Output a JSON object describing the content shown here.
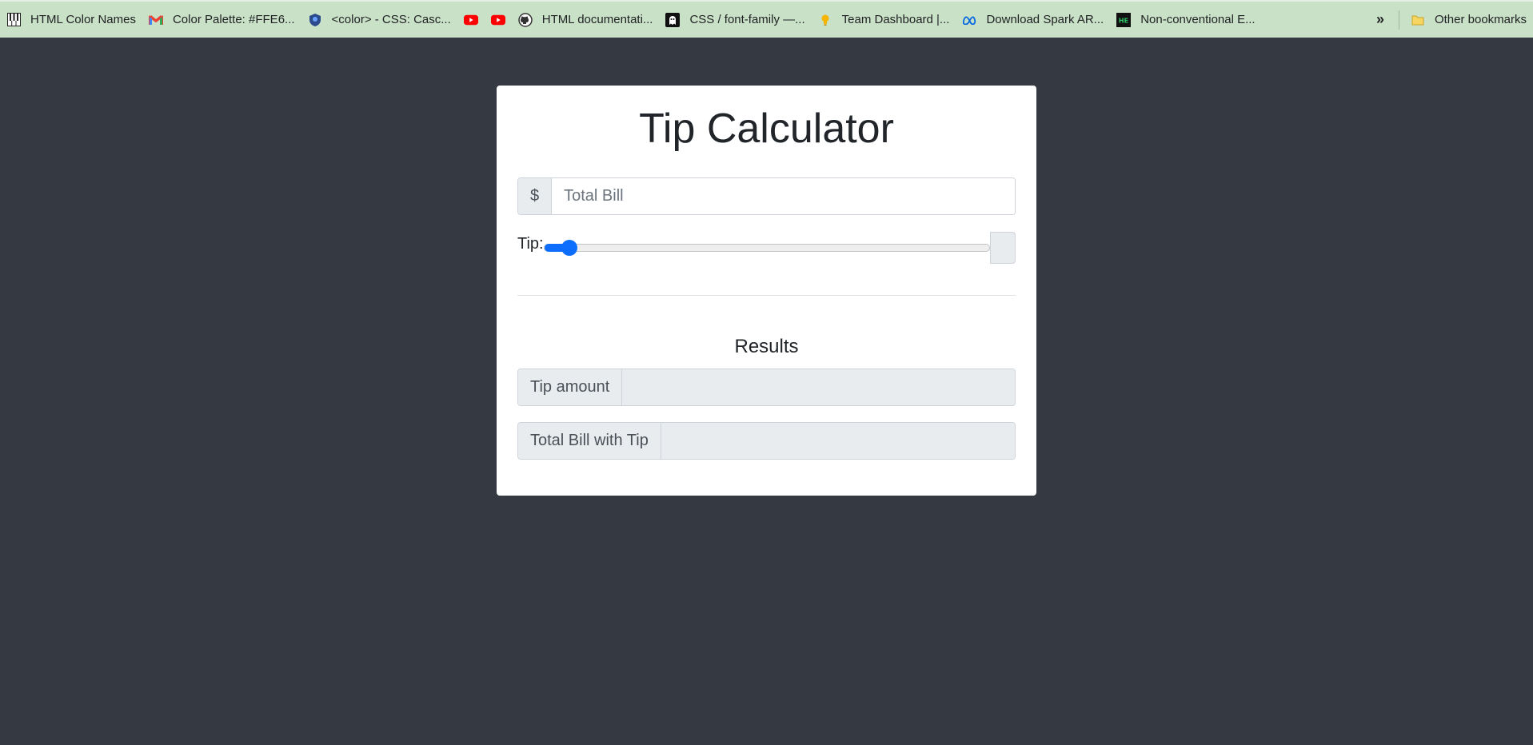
{
  "bookmarks": [
    {
      "label": "HTML Color Names",
      "icon": "piano-keys-icon"
    },
    {
      "label": "Color Palette: #FFE6...",
      "icon": "gmail-icon"
    },
    {
      "label": "<color> - CSS: Casc...",
      "icon": "shield-icon"
    },
    {
      "label": "",
      "icon": "youtube-icon"
    },
    {
      "label": "",
      "icon": "youtube-icon"
    },
    {
      "label": "HTML documentati...",
      "icon": "github-icon"
    },
    {
      "label": "CSS / font-family —...",
      "icon": "ghost-icon"
    },
    {
      "label": "Team Dashboard |...",
      "icon": "lightbulb-icon"
    },
    {
      "label": "Download Spark AR...",
      "icon": "meta-icon"
    },
    {
      "label": "Non-conventional E...",
      "icon": "hackerearth-icon"
    }
  ],
  "bookmarks_more": "»",
  "other_bookmarks": {
    "label": "Other bookmarks",
    "icon": "folder-icon"
  },
  "calculator": {
    "title": "Tip Calculator",
    "currency_symbol": "$",
    "bill_placeholder": "Total Bill",
    "bill_value": "",
    "tip_label": "Tip:",
    "tip_slider_fraction": 0.04,
    "tip_output": "",
    "results_heading": "Results",
    "tip_amount_label": "Tip amount",
    "tip_amount_value": "",
    "total_label": "Total Bill with Tip",
    "total_value": ""
  },
  "colors": {
    "page_background": "#353941",
    "bookmarks_bar": "#c9e2c7",
    "accent": "#0d6efd",
    "addon_background": "#e9ecef"
  }
}
